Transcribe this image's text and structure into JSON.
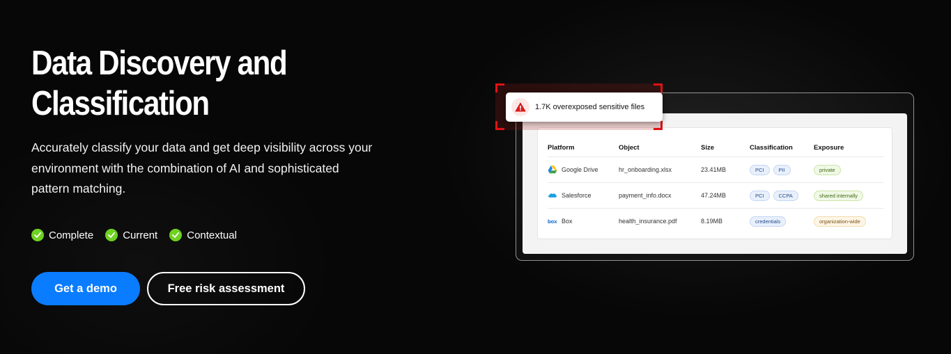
{
  "hero": {
    "title_line1": "Data Discovery and",
    "title_line2": "Classification",
    "description": "Accurately classify your data and get deep visibility across your environment with the combination of AI and sophisticated pattern matching.",
    "features": [
      "Complete",
      "Current",
      "Contextual"
    ],
    "cta_primary": "Get a demo",
    "cta_secondary": "Free risk assessment"
  },
  "alert": {
    "text": "1.7K overexposed sensitive files",
    "icon": "warning-triangle-icon"
  },
  "table": {
    "headers": [
      "Platform",
      "Object",
      "Size",
      "Classification",
      "Exposure"
    ],
    "rows": [
      {
        "platform": "Google Drive",
        "icon": "google-drive-icon",
        "object": "hr_onboarding.xlsx",
        "size": "23.41MB",
        "classification": [
          "PCI",
          "PII"
        ],
        "exposure": "private",
        "exposure_tone": "green"
      },
      {
        "platform": "Salesforce",
        "icon": "salesforce-icon",
        "object": "payment_info.docx",
        "size": "47.24MB",
        "classification": [
          "PCI",
          "CCPA"
        ],
        "exposure": "shared internally",
        "exposure_tone": "green"
      },
      {
        "platform": "Box",
        "icon": "box-icon",
        "object": "health_insurance.pdf",
        "size": "8.19MB",
        "classification": [
          "credentials"
        ],
        "exposure": "organization-wide",
        "exposure_tone": "orange"
      }
    ]
  },
  "colors": {
    "primary": "#0a7cff",
    "check": "#6fd121",
    "alert_red": "#e01212",
    "background": "#070707"
  }
}
